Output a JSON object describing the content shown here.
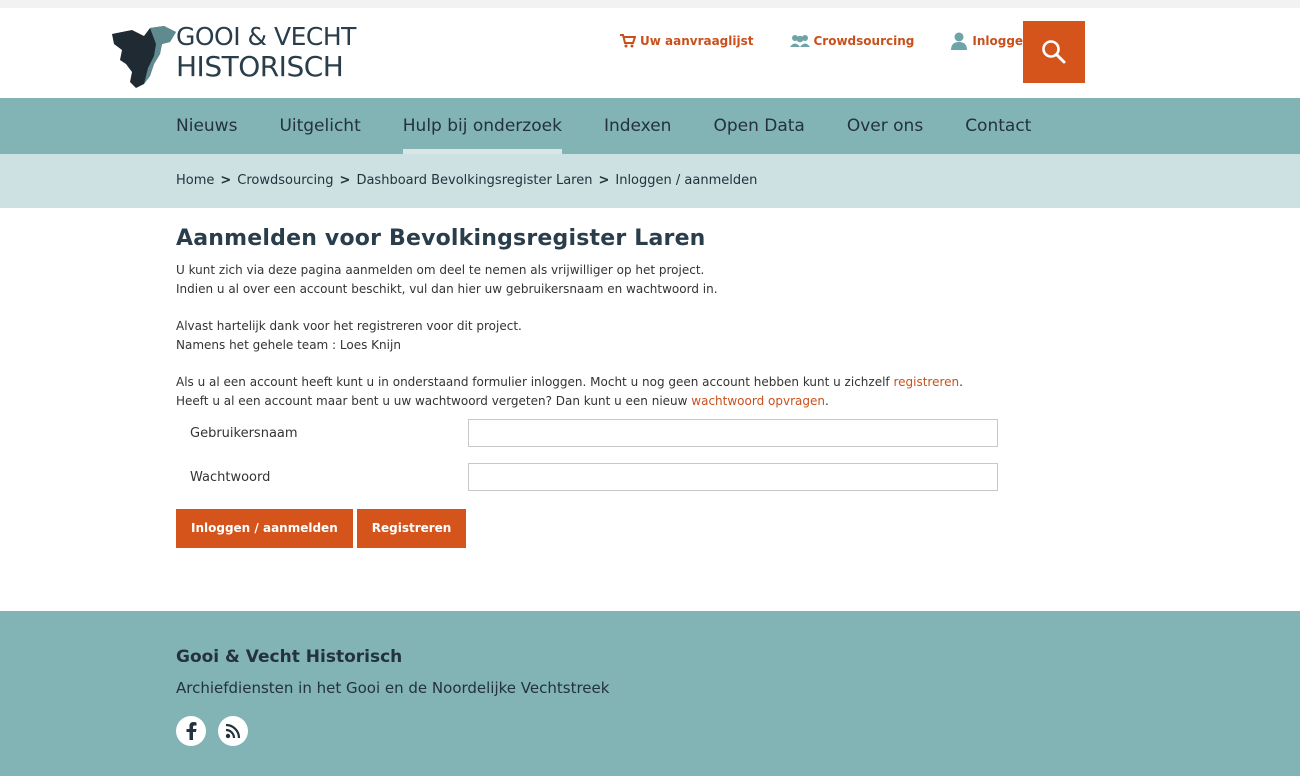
{
  "logo": {
    "line1": "GOOI & VECHT",
    "line2": "HISTORISCH"
  },
  "toplinks": [
    {
      "label": "Uw aanvraaglijst",
      "icon": "cart-icon"
    },
    {
      "label": "Crowdsourcing",
      "icon": "people-icon"
    },
    {
      "label": "Inloggen",
      "icon": "user-icon"
    }
  ],
  "nav": [
    "Nieuws",
    "Uitgelicht",
    "Hulp bij onderzoek",
    "Indexen",
    "Open Data",
    "Over ons",
    "Contact"
  ],
  "breadcrumb": [
    "Home",
    "Crowdsourcing",
    "Dashboard Bevolkingsregister Laren",
    "Inloggen / aanmelden"
  ],
  "page": {
    "title": "Aanmelden voor Bevolkingsregister Laren",
    "intro1": "U kunt zich via deze pagina aanmelden om deel te nemen als vrijwilliger op het project.",
    "intro2": "Indien u al over een account beschikt, vul dan hier uw gebruikersnaam en wachtwoord in.",
    "thanks1": "Alvast hartelijk dank voor het registreren voor dit project.",
    "thanks2": "Namens het gehele team : Loes Knijn",
    "info1_pre": "Als u al een account heeft kunt u in onderstaand formulier inloggen. Mocht u nog geen account hebben kunt u zichzelf ",
    "info1_link": "registreren",
    "info1_post": ".",
    "info2_pre": "Heeft u al een account maar bent u uw wachtwoord vergeten? Dan kunt u een nieuw ",
    "info2_link": "wachtwoord opvragen",
    "info2_post": "."
  },
  "form": {
    "username_label": "Gebruikersnaam",
    "username_value": "",
    "password_label": "Wachtwoord",
    "password_value": "",
    "login_button": "Inloggen / aanmelden",
    "register_button": "Registreren"
  },
  "footer": {
    "title": "Gooi & Vecht Historisch",
    "subtitle": "Archiefdiensten in het Gooi en de Noordelijke Vechtstreek",
    "social": [
      "facebook-icon",
      "rss-icon"
    ]
  },
  "colors": {
    "accent": "#d4541c",
    "nav_bg": "#82b3b5",
    "crumb_bg": "#cde0e2",
    "text_dark": "#2a3d4a"
  }
}
